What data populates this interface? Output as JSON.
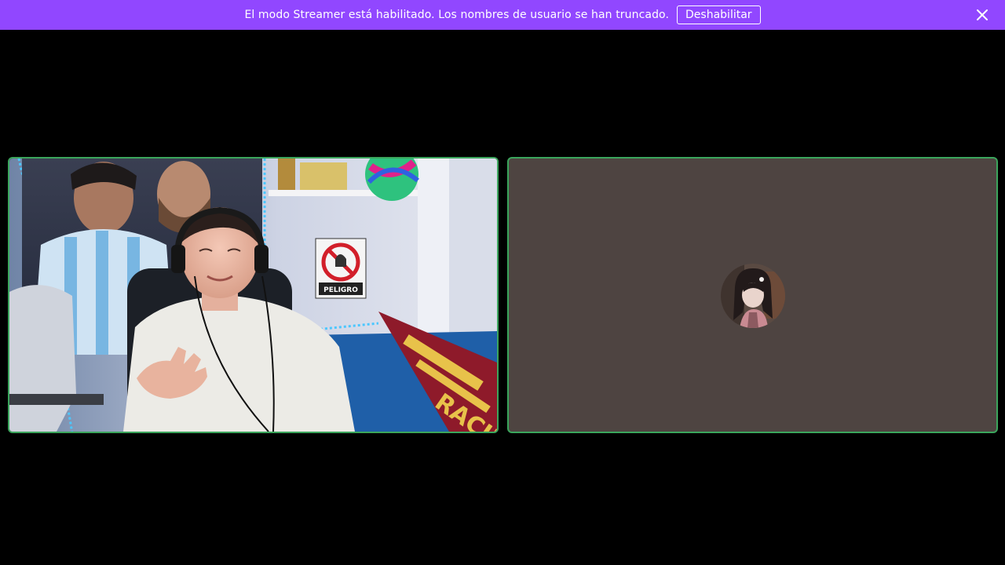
{
  "banner": {
    "message": "El modo Streamer está habilitado. Los nombres de usuario se han truncado.",
    "button_label": "Deshabilitar",
    "close_icon": "close-icon",
    "background_color": "#9147ff"
  },
  "call": {
    "speaking_border_color": "#3ba55c",
    "participants": [
      {
        "type": "video",
        "description_icon": "webcam-video"
      },
      {
        "type": "avatar",
        "avatar_icon": "user-avatar",
        "tile_color": "#4e4441"
      }
    ],
    "video_scene": {
      "sign_text": "PELIGRO",
      "scarf_text": "RACING"
    }
  }
}
